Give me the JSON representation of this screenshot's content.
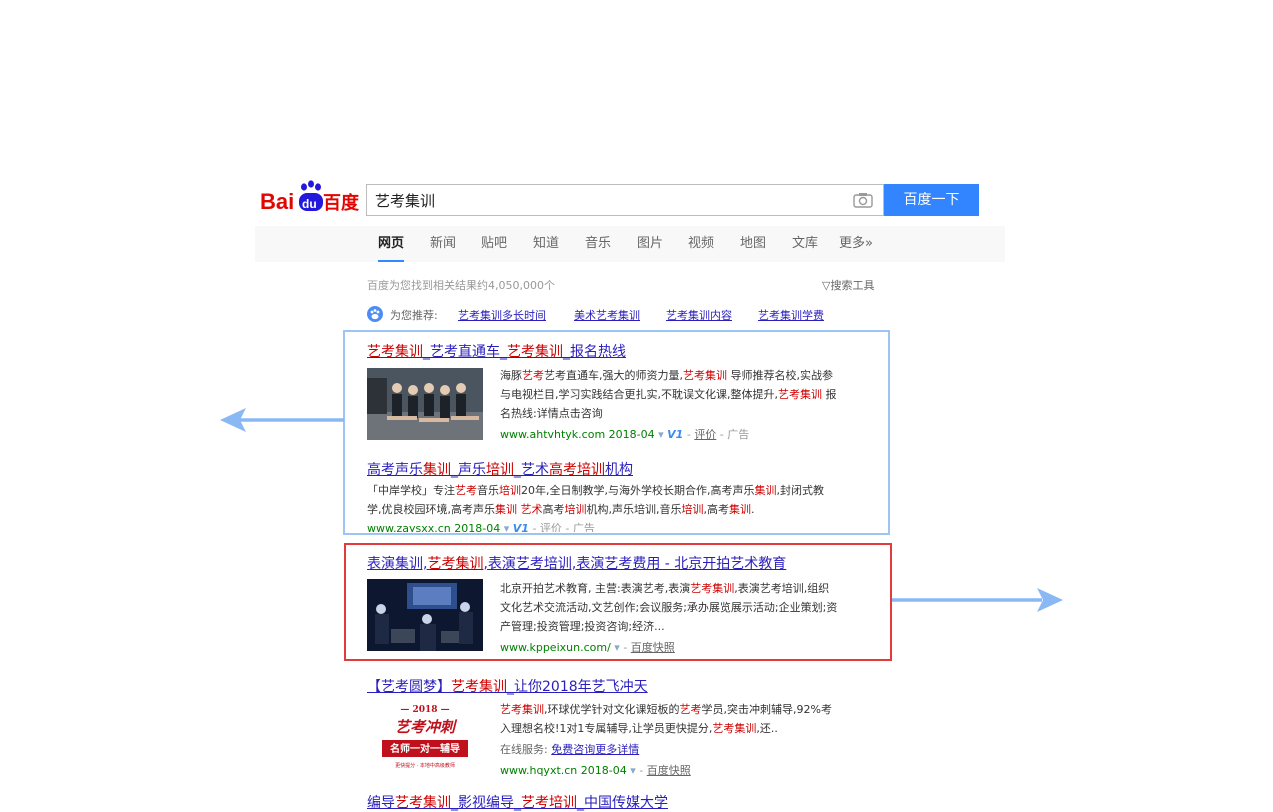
{
  "logo": {
    "text_bai": "Bai",
    "text_du": "du",
    "text_cn": "百度"
  },
  "search": {
    "value": "艺考集训",
    "button_label": "百度一下"
  },
  "tabs": [
    "网页",
    "新闻",
    "贴吧",
    "知道",
    "音乐",
    "图片",
    "视频",
    "地图",
    "文库",
    "更多»"
  ],
  "result_count": "百度为您找到相关结果约4,050,000个",
  "search_tools": "搜索工具",
  "recommend": {
    "label": "为您推荐:",
    "links": [
      "艺考集训多长时间",
      "美术艺考集训",
      "艺考集训内容",
      "艺考集训学费"
    ]
  },
  "results": [
    {
      "title": [
        "艺考集训",
        "_艺考直通车_",
        "艺考集训",
        "_报名热线"
      ],
      "desc_lines": [
        [
          "海豚",
          "艺考",
          "艺考直通车,强大的师资力量,",
          "艺考集训",
          " 导师推荐名校,实战参"
        ],
        [
          "与电视栏目,学习实践结合更扎实,不耽误文化课,整体提升,",
          "艺考集训",
          " 报"
        ],
        [
          "名热线:详情点击咨询"
        ]
      ],
      "url": "www.ahtvhtyk.com",
      "date": "2018-04",
      "badge": "V1",
      "tail": [
        "评价",
        "广告"
      ]
    },
    {
      "title": [
        "高考声乐",
        "集训",
        "_声乐",
        "培训",
        "_艺术",
        "高考",
        "培训",
        "机构"
      ],
      "desc_lines": [
        [
          "「中岸学校」专注",
          "艺考",
          "音乐",
          "培训",
          "20年,全日制教学,与海外学校长期合作,高考声乐",
          "集训",
          ",封闭式教"
        ],
        [
          "学,优良校园环境,高考声乐",
          "集训",
          " 艺术",
          "高考",
          "培训",
          "机构,声乐培训,音乐",
          "培训",
          ",高考",
          "集训",
          "."
        ]
      ],
      "url": "www.zaysxx.cn",
      "date": "2018-04",
      "badge": "V1",
      "tail": [
        "评价",
        "广告"
      ]
    },
    {
      "title": [
        "表演集训,",
        "艺考集训",
        ",表演艺考培训,表演艺考费用 - 北京开拍艺术教育"
      ],
      "desc_lines": [
        [
          "北京开拍艺术教育, 主营:表演艺考,表演",
          "艺考集训",
          ",表演艺考培训,组织"
        ],
        [
          "文化艺术交流活动,文艺创作;会议服务;承办展览展示活动;企业策划;资"
        ],
        [
          "产管理;投资管理;投资咨询;经济..."
        ]
      ],
      "url": "www.kppeixun.com/",
      "tail": [
        "百度快照"
      ]
    },
    {
      "title": [
        "【艺考圆梦】",
        "艺考集训",
        "_让你2018年艺飞冲天"
      ],
      "desc_lines": [
        [
          "艺考集训",
          ",环球优学针对文化课短板的",
          "艺考",
          "学员,突击冲刺辅导,92%考"
        ],
        [
          "入理想名校!1对1专属辅导,让学员更快提分,",
          "艺考集训",
          ",还.."
        ]
      ],
      "service_label": "在线服务:",
      "service_link": "免费咨询更多详情",
      "url": "www.hqyxt.cn",
      "date": "2018-04",
      "tail": [
        "百度快照"
      ],
      "thumb": {
        "year": "— 2018 —",
        "headline": "艺考冲刺",
        "banner": "名师一对一辅导",
        "small": "更快提分 · 本地中高级教师"
      }
    },
    {
      "title": [
        "编导",
        "艺考集训",
        "_影视编导_",
        "艺考培训",
        "_中国传媒大学"
      ]
    }
  ],
  "colors": {
    "accent": "#3385ff",
    "link": "#2a1fbd",
    "highlight": "#cc0000",
    "url_green": "#008000",
    "blue_box": "#9bc5f2",
    "red_box": "#e23b3b",
    "arrow": "#8ab8f5"
  }
}
